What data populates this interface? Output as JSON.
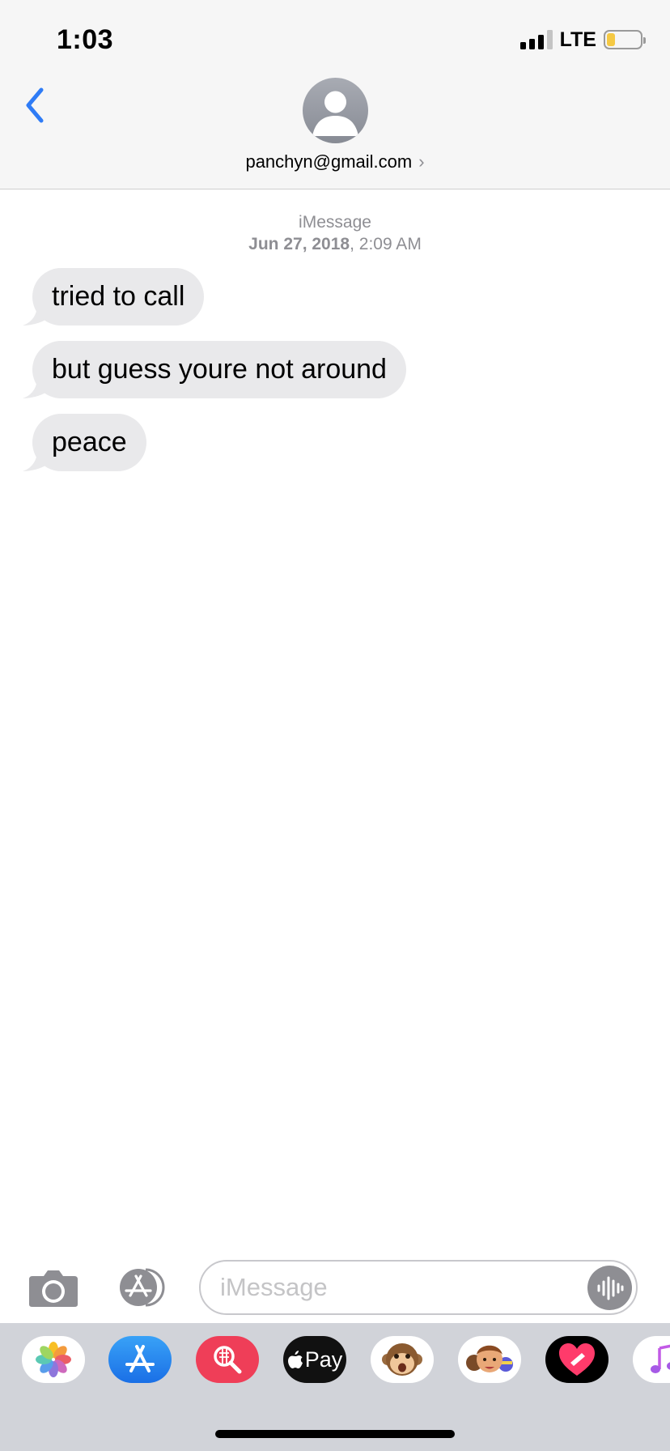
{
  "status_bar": {
    "time": "1:03",
    "network": "LTE",
    "battery_level": 0.25
  },
  "header": {
    "contact": "panchyn@gmail.com"
  },
  "thread": {
    "service": "iMessage",
    "date": "Jun 27, 2018",
    "time": ", 2:09 AM",
    "messages": [
      {
        "text": "tried to call"
      },
      {
        "text": "but guess youre not around"
      },
      {
        "text": "peace"
      }
    ]
  },
  "compose": {
    "placeholder": "iMessage"
  },
  "app_drawer": {
    "apps": [
      {
        "name": "photos-app-icon"
      },
      {
        "name": "app-store-app-icon"
      },
      {
        "name": "images-search-app-icon"
      },
      {
        "name": "apple-pay-app-icon",
        "label": "Pay"
      },
      {
        "name": "animoji-app-icon"
      },
      {
        "name": "memoji-app-icon"
      },
      {
        "name": "digital-touch-app-icon"
      },
      {
        "name": "music-app-icon"
      }
    ]
  },
  "colors": {
    "accent": "#2f7cf6",
    "received_bubble": "#e9e9eb",
    "meta_text": "#8e8e93",
    "drawer": "#d1d3d9"
  }
}
